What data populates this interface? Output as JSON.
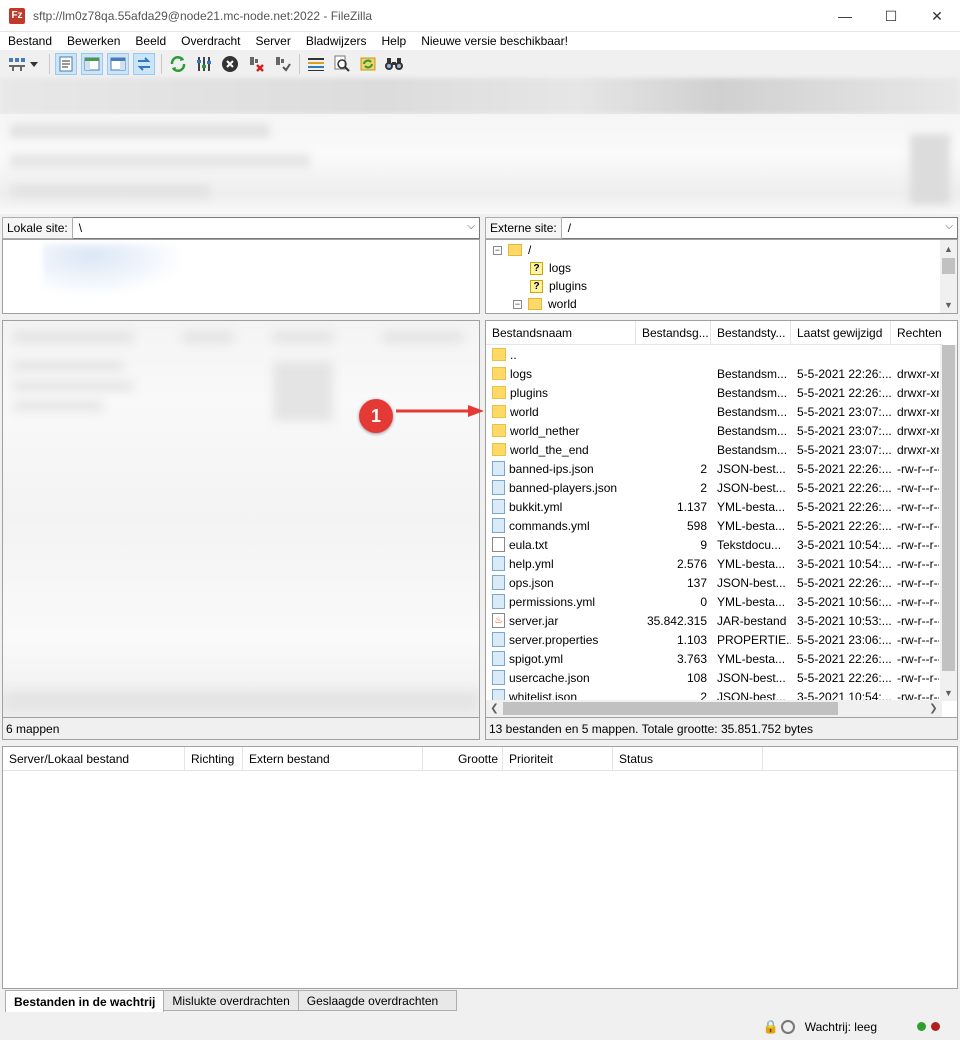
{
  "window": {
    "title": "sftp://lm0z78qa.55afda29@node21.mc-node.net:2022 - FileZilla",
    "app_icon_text": "Fz",
    "minimize": "—",
    "maximize": "☐",
    "close": "✕"
  },
  "menu": [
    "Bestand",
    "Bewerken",
    "Beeld",
    "Overdracht",
    "Server",
    "Bladwijzers",
    "Help",
    "Nieuwe versie beschikbaar!"
  ],
  "toolbar": {
    "icons": [
      "site-manager",
      "toggle-log",
      "toggle-local-tree",
      "toggle-remote-tree",
      "toggle-queue",
      "refresh",
      "process-queue",
      "cancel",
      "disconnect",
      "reconnect",
      "directory-listing-filters",
      "search",
      "sync-browse",
      "find-files"
    ]
  },
  "local": {
    "label": "Lokale site:",
    "path": "\\",
    "status": "6 mappen"
  },
  "remote": {
    "label": "Externe site:",
    "path": "/",
    "tree": [
      {
        "name": "/",
        "type": "root"
      },
      {
        "name": "logs",
        "type": "unknown"
      },
      {
        "name": "plugins",
        "type": "unknown"
      },
      {
        "name": "world",
        "type": "folder"
      }
    ],
    "columns": [
      "Bestandsnaam",
      "Bestandsg...",
      "Bestandsty...",
      "Laatst gewijzigd",
      "Rechten"
    ],
    "files": [
      {
        "name": "..",
        "size": "",
        "type": "",
        "modified": "",
        "perm": "",
        "icon": "folder"
      },
      {
        "name": "logs",
        "size": "",
        "type": "Bestandsm...",
        "modified": "5-5-2021 22:26:...",
        "perm": "drwxr-xr-x",
        "icon": "folder"
      },
      {
        "name": "plugins",
        "size": "",
        "type": "Bestandsm...",
        "modified": "5-5-2021 22:26:...",
        "perm": "drwxr-xr-x",
        "icon": "folder"
      },
      {
        "name": "world",
        "size": "",
        "type": "Bestandsm...",
        "modified": "5-5-2021 23:07:...",
        "perm": "drwxr-xr-x",
        "icon": "folder"
      },
      {
        "name": "world_nether",
        "size": "",
        "type": "Bestandsm...",
        "modified": "5-5-2021 23:07:...",
        "perm": "drwxr-xr-x",
        "icon": "folder"
      },
      {
        "name": "world_the_end",
        "size": "",
        "type": "Bestandsm...",
        "modified": "5-5-2021 23:07:...",
        "perm": "drwxr-xr-x",
        "icon": "folder"
      },
      {
        "name": "banned-ips.json",
        "size": "2",
        "type": "JSON-best...",
        "modified": "5-5-2021 22:26:...",
        "perm": "-rw-r--r--",
        "icon": "file"
      },
      {
        "name": "banned-players.json",
        "size": "2",
        "type": "JSON-best...",
        "modified": "5-5-2021 22:26:...",
        "perm": "-rw-r--r--",
        "icon": "file"
      },
      {
        "name": "bukkit.yml",
        "size": "1.137",
        "type": "YML-besta...",
        "modified": "5-5-2021 22:26:...",
        "perm": "-rw-r--r--",
        "icon": "file"
      },
      {
        "name": "commands.yml",
        "size": "598",
        "type": "YML-besta...",
        "modified": "5-5-2021 22:26:...",
        "perm": "-rw-r--r--",
        "icon": "file"
      },
      {
        "name": "eula.txt",
        "size": "9",
        "type": "Tekstdocu...",
        "modified": "3-5-2021 10:54:...",
        "perm": "-rw-r--r--",
        "icon": "text"
      },
      {
        "name": "help.yml",
        "size": "2.576",
        "type": "YML-besta...",
        "modified": "3-5-2021 10:54:...",
        "perm": "-rw-r--r--",
        "icon": "file"
      },
      {
        "name": "ops.json",
        "size": "137",
        "type": "JSON-best...",
        "modified": "5-5-2021 22:26:...",
        "perm": "-rw-r--r--",
        "icon": "file"
      },
      {
        "name": "permissions.yml",
        "size": "0",
        "type": "YML-besta...",
        "modified": "3-5-2021 10:56:...",
        "perm": "-rw-r--r--",
        "icon": "file"
      },
      {
        "name": "server.jar",
        "size": "35.842.315",
        "type": "JAR-bestand",
        "modified": "3-5-2021 10:53:...",
        "perm": "-rw-r--r--",
        "icon": "jar"
      },
      {
        "name": "server.properties",
        "size": "1.103",
        "type": "PROPERTIE...",
        "modified": "5-5-2021 23:06:...",
        "perm": "-rw-r--r--",
        "icon": "file"
      },
      {
        "name": "spigot.yml",
        "size": "3.763",
        "type": "YML-besta...",
        "modified": "5-5-2021 22:26:...",
        "perm": "-rw-r--r--",
        "icon": "file"
      },
      {
        "name": "usercache.json",
        "size": "108",
        "type": "JSON-best...",
        "modified": "5-5-2021 22:26:...",
        "perm": "-rw-r--r--",
        "icon": "file"
      },
      {
        "name": "whitelist.json",
        "size": "2",
        "type": "JSON-best...",
        "modified": "3-5-2021 10:54:...",
        "perm": "-rw-r--r--",
        "icon": "file"
      }
    ],
    "status": "13 bestanden en 5 mappen. Totale grootte: 35.851.752 bytes"
  },
  "queue": {
    "columns": [
      "Server/Lokaal bestand",
      "Richting",
      "Extern bestand",
      "Grootte",
      "Prioriteit",
      "Status"
    ]
  },
  "tabs": [
    "Bestanden in de wachtrij",
    "Mislukte overdrachten",
    "Geslaagde overdrachten"
  ],
  "statusbar": {
    "queue": "Wachtrij: leeg"
  },
  "annotation": {
    "number": "1",
    "color": "#e53935"
  }
}
